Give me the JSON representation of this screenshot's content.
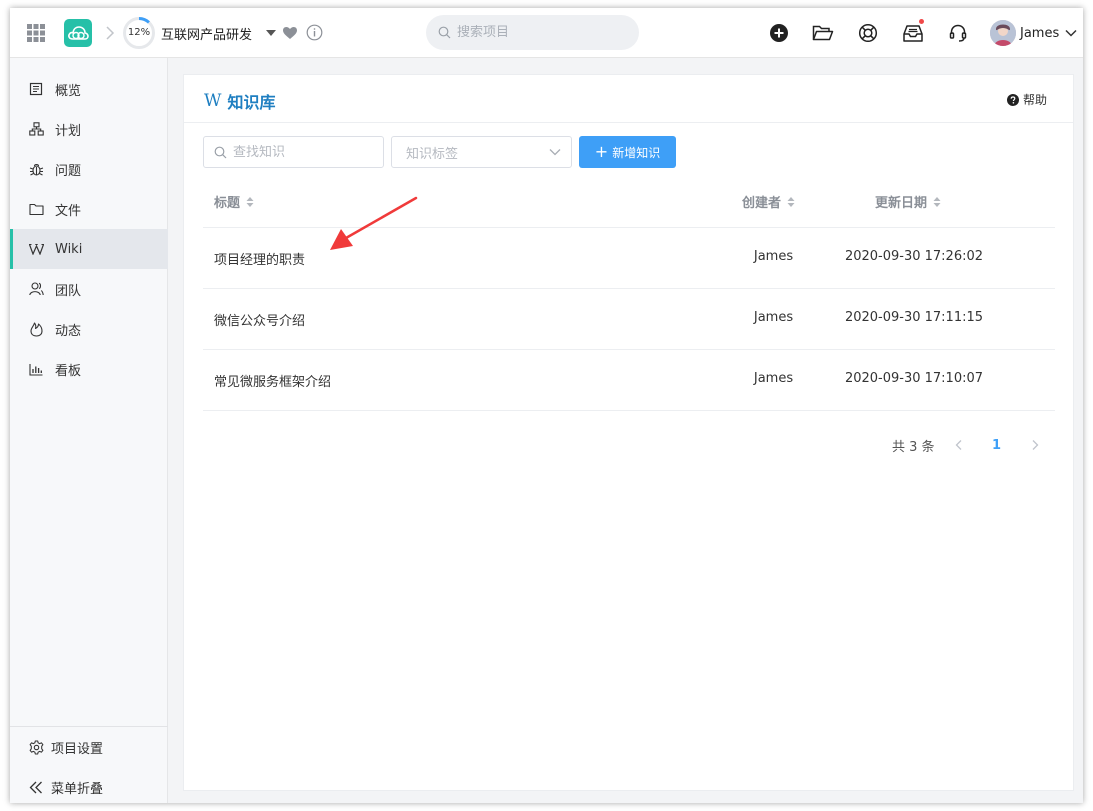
{
  "topbar": {
    "progress_label": "12%",
    "progress_fraction": 0.12,
    "project_name": "互联网产品研发",
    "search_placeholder": "搜索项目",
    "user_name": "James",
    "brand_color": "#26c0a8"
  },
  "sidebar": {
    "items": [
      {
        "label": "概览",
        "icon": "overview-icon"
      },
      {
        "label": "计划",
        "icon": "plan-icon"
      },
      {
        "label": "问题",
        "icon": "bug-icon"
      },
      {
        "label": "文件",
        "icon": "folder-icon"
      },
      {
        "label": "Wiki",
        "icon": "wiki-icon"
      },
      {
        "label": "团队",
        "icon": "team-icon"
      },
      {
        "label": "动态",
        "icon": "activity-icon"
      },
      {
        "label": "看板",
        "icon": "board-icon"
      }
    ],
    "active": "Wiki",
    "settings_label": "项目设置",
    "collapse_label": "菜单折叠"
  },
  "main": {
    "title_mark": "W",
    "title": "知识库",
    "help_label": "帮助",
    "search_placeholder": "查找知识",
    "tag_placeholder": "知识标签",
    "add_label": "新增知识",
    "accent_color": "#3e9ff7",
    "columns": {
      "title": "标题",
      "creator": "创建者",
      "updated": "更新日期"
    },
    "rows": [
      {
        "title": "项目经理的职责",
        "creator": "James",
        "updated": "2020-09-30 17:26:02"
      },
      {
        "title": "微信公众号介绍",
        "creator": "James",
        "updated": "2020-09-30 17:11:15"
      },
      {
        "title": "常见微服务框架介绍",
        "creator": "James",
        "updated": "2020-09-30 17:10:07"
      }
    ],
    "pagination": {
      "total_label": "共 3 条",
      "current_page": "1"
    }
  }
}
